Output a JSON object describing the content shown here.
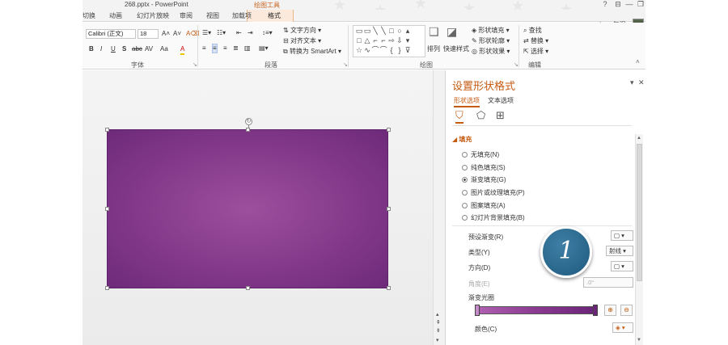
{
  "window": {
    "title": "268.pptx - PowerPoint",
    "context_tool_label": "绘图工具",
    "controls": [
      "?",
      "⊟",
      "—",
      "❐"
    ]
  },
  "tabs": [
    "切换",
    "动画",
    "幻灯片放映",
    "审阅",
    "视图",
    "加载项",
    "格式"
  ],
  "active_tab": "格式",
  "user": {
    "name": "qiwen气温 ▾"
  },
  "ribbon": {
    "font": {
      "name": "Calibri (正文)",
      "size": "18",
      "grow": "A˄",
      "shrink": "A˅",
      "clear": "A⌫",
      "bold": "B",
      "italic": "I",
      "underline": "U",
      "shadow": "S",
      "strike": "abc",
      "spacing": "AV",
      "case": "Aa",
      "color": "A",
      "group_label": "字体"
    },
    "paragraph": {
      "text_direction": "文字方向 ▾",
      "align_text": "对齐文本 ▾",
      "smartart": "转换为 SmartArt ▾",
      "group_label": "段落"
    },
    "drawing": {
      "arrange": "排列",
      "quick_styles": "快速样式",
      "shape_fill": "形状填充 ▾",
      "shape_outline": "形状轮廓 ▾",
      "shape_effects": "形状效果 ▾",
      "group_label": "绘图"
    },
    "editing": {
      "find": "查找",
      "replace": "替换 ▾",
      "select": "选择 ▾",
      "group_label": "编辑"
    }
  },
  "pane": {
    "title": "设置形状格式",
    "subtabs": [
      "形状选项",
      "文本选项"
    ],
    "active_subtab": "形状选项",
    "section": "填充",
    "fill_options": [
      {
        "label": "无填充(N)",
        "selected": false
      },
      {
        "label": "纯色填充(S)",
        "selected": false
      },
      {
        "label": "渐变填充(G)",
        "selected": true
      },
      {
        "label": "图片或纹理填充(P)",
        "selected": false
      },
      {
        "label": "图案填充(A)",
        "selected": false
      },
      {
        "label": "幻灯片背景填充(B)",
        "selected": false
      }
    ],
    "props": {
      "preset": "预设渐变(R)",
      "type": "类型(Y)",
      "type_value": "射线",
      "direction": "方向(D)",
      "angle": "角度(E)",
      "angle_value": ".0°",
      "stops": "渐变光圈",
      "color": "颜色(C)"
    }
  },
  "shape_fill_colors": {
    "center": "#9c4f9d",
    "edge": "#6e2a7a"
  },
  "step_badge": "1"
}
